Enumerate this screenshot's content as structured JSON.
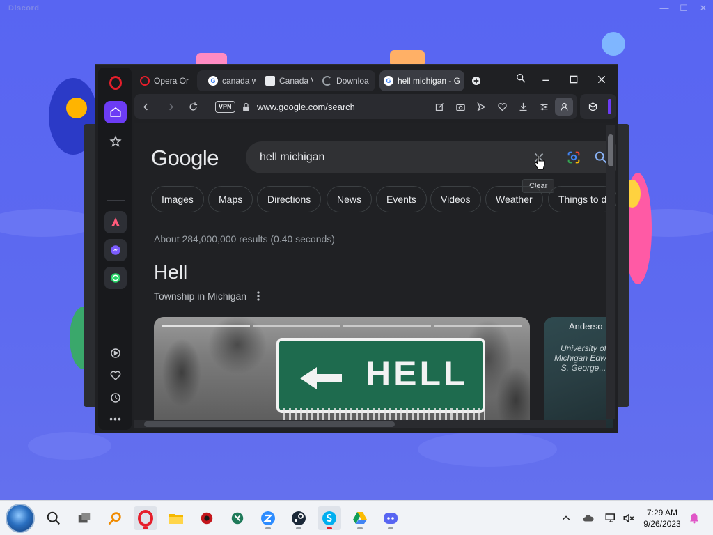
{
  "discord": {
    "title": "Discord"
  },
  "browser": {
    "tabs": [
      {
        "title": "Opera Or",
        "icon": "opera-icon"
      },
      {
        "title": "canada w",
        "icon": "google-icon"
      },
      {
        "title": "Canada V",
        "icon": "site-icon"
      },
      {
        "title": "Downloa",
        "icon": "loading-icon"
      },
      {
        "title": "hell michigan - G",
        "icon": "google-icon",
        "active": true
      }
    ],
    "vpn_label": "VPN",
    "url": "www.google.com/search",
    "accent_color": "#6c3cf5"
  },
  "google": {
    "logo_text": "Google",
    "query": "hell michigan",
    "clear_tooltip": "Clear",
    "chips": [
      "Images",
      "Maps",
      "Directions",
      "News",
      "Events",
      "Videos",
      "Weather",
      "Things to d"
    ],
    "result_stats": "About 284,000,000 results (0.40 seconds)",
    "knowledge_panel": {
      "title": "Hell",
      "subtitle": "Township in Michigan",
      "sign_text": "HELL",
      "map_label_top": "Anderso",
      "map_label": "University of Michigan Edwin S. George..."
    }
  },
  "taskbar": {
    "time": "7:29 AM",
    "date": "9/26/2023",
    "apps": [
      "search",
      "task-view",
      "magnifier",
      "opera",
      "file-explorer",
      "settings",
      "app-green",
      "zoom",
      "steam",
      "skype",
      "google-drive",
      "discord"
    ]
  }
}
